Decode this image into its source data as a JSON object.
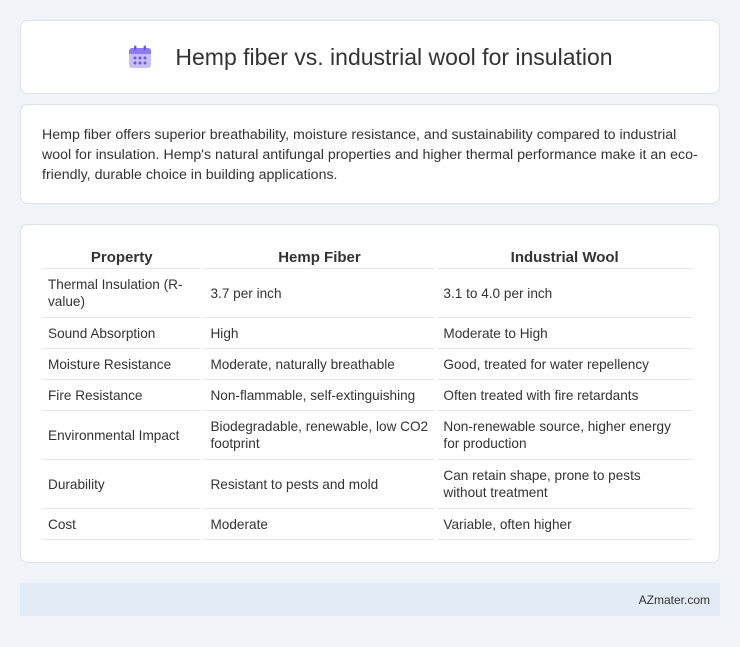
{
  "header": {
    "title": "Hemp fiber vs. industrial wool for insulation",
    "icon": "calendar-icon",
    "icon_color": "#8b7cf0"
  },
  "summary": {
    "text": "Hemp fiber offers superior breathability, moisture resistance, and sustainability compared to industrial wool for insulation. Hemp's natural antifungal properties and higher thermal performance make it an eco-friendly, durable choice in building applications."
  },
  "table": {
    "headers": [
      "Property",
      "Hemp Fiber",
      "Industrial Wool"
    ],
    "rows": [
      {
        "property": "Thermal Insulation (R-value)",
        "hemp": "3.7 per inch",
        "wool": "3.1 to 4.0 per inch"
      },
      {
        "property": "Sound Absorption",
        "hemp": "High",
        "wool": "Moderate to High"
      },
      {
        "property": "Moisture Resistance",
        "hemp": "Moderate, naturally breathable",
        "wool": "Good, treated for water repellency"
      },
      {
        "property": "Fire Resistance",
        "hemp": "Non-flammable, self-extinguishing",
        "wool": "Often treated with fire retardants"
      },
      {
        "property": "Environmental Impact",
        "hemp": "Biodegradable, renewable, low CO2 footprint",
        "wool": "Non-renewable source, higher energy for production"
      },
      {
        "property": "Durability",
        "hemp": "Resistant to pests and mold",
        "wool": "Can retain shape, prone to pests without treatment"
      },
      {
        "property": "Cost",
        "hemp": "Moderate",
        "wool": "Variable, often higher"
      }
    ]
  },
  "footer": {
    "text": "AZmater.com"
  }
}
